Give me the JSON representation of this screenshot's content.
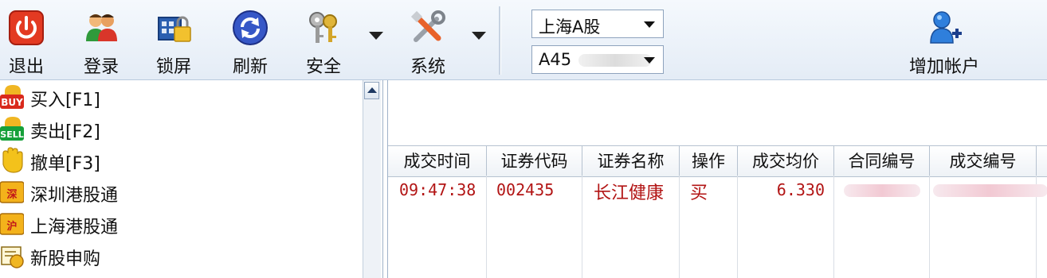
{
  "toolbar": {
    "buttons": [
      {
        "label": "退出",
        "icon": "power-icon"
      },
      {
        "label": "登录",
        "icon": "users-icon"
      },
      {
        "label": "锁屏",
        "icon": "lock-screen-icon"
      },
      {
        "label": "刷新",
        "icon": "refresh-icon"
      },
      {
        "label": "安全",
        "icon": "keys-icon"
      },
      {
        "label": "系统",
        "icon": "tools-icon"
      }
    ],
    "market_select": "上海A股",
    "account_select": "A45",
    "add_account_label": "增加帐户"
  },
  "menu": {
    "items": [
      {
        "label": "买入[F1]",
        "icon": "buy-icon"
      },
      {
        "label": "卖出[F2]",
        "icon": "sell-icon"
      },
      {
        "label": "撤单[F3]",
        "icon": "cancel-hand-icon"
      },
      {
        "label": "深圳港股通",
        "icon": "shenzhen-hk-connect-icon"
      },
      {
        "label": "上海港股通",
        "icon": "shanghai-hk-connect-icon"
      },
      {
        "label": "新股申购",
        "icon": "ipo-subscribe-icon"
      }
    ]
  },
  "grid": {
    "columns": [
      "成交时间",
      "证券代码",
      "证券名称",
      "操作",
      "成交均价",
      "合同编号",
      "成交编号"
    ],
    "rows": [
      {
        "time": "09:47:38",
        "code": "002435",
        "name": "长江健康",
        "action": "买",
        "avg_price": "6.330"
      }
    ]
  },
  "colors": {
    "row_text": "#b21414",
    "toolbar_bg": "#e4ecf6"
  }
}
